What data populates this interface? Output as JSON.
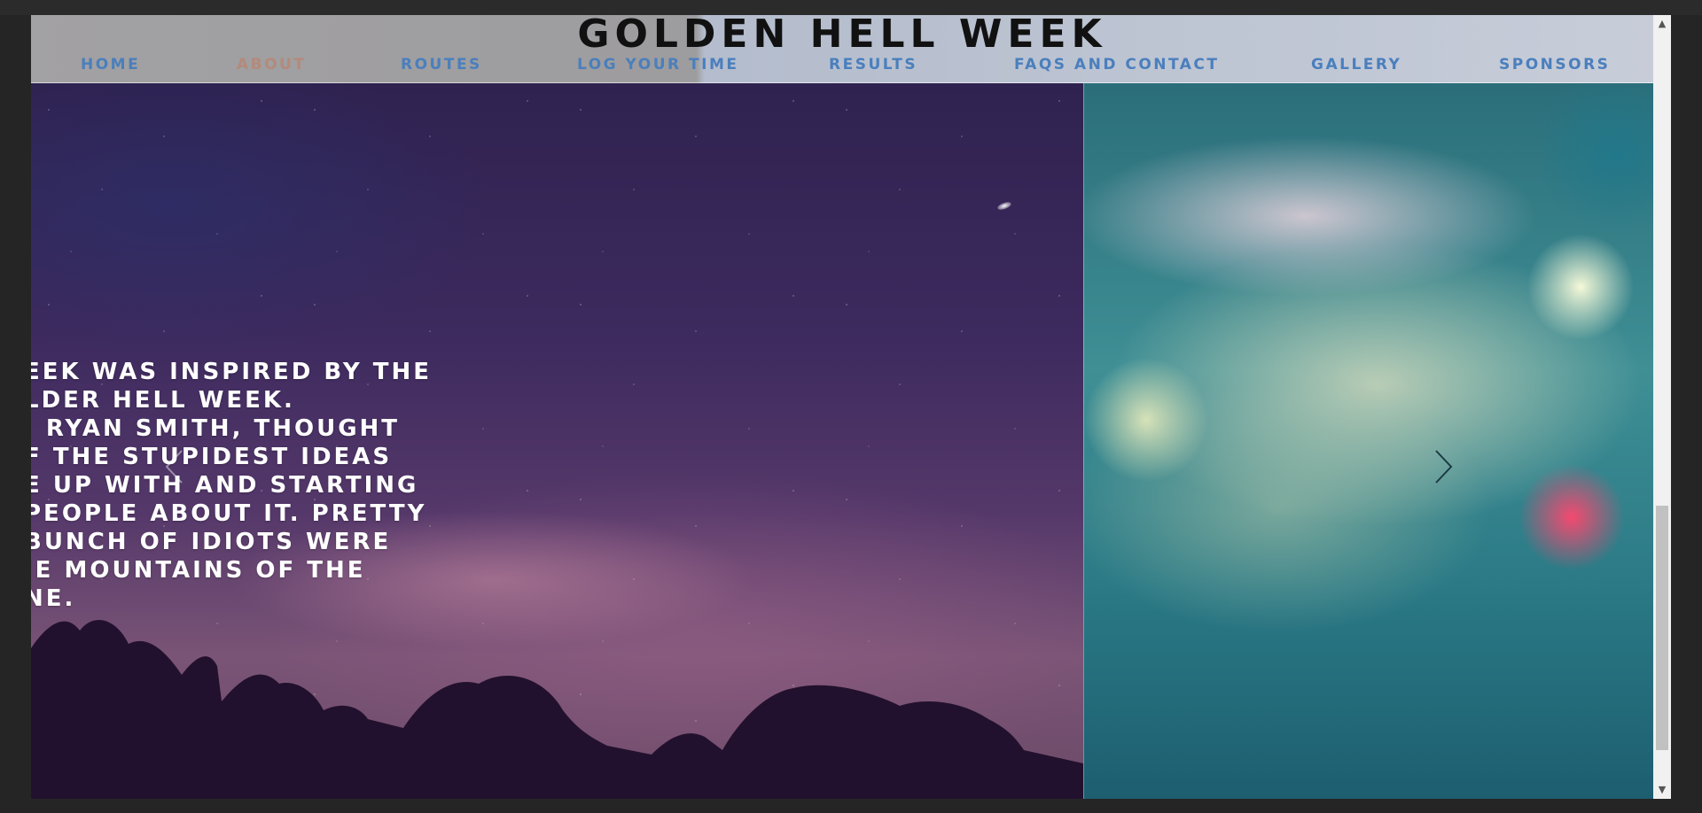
{
  "header": {
    "site_title": "GOLDEN HELL WEEK",
    "nav": [
      {
        "label": "HOME"
      },
      {
        "label": "ABOUT"
      },
      {
        "label": "ROUTES"
      },
      {
        "label": "LOG YOUR TIME"
      },
      {
        "label": "RESULTS"
      },
      {
        "label": "FAQS AND CONTACT"
      },
      {
        "label": "GALLERY"
      },
      {
        "label": "SPONSORS"
      }
    ],
    "active_nav": "ABOUT"
  },
  "slide": {
    "text_lines": [
      "EEK WAS INSPIRED BY THE",
      "LDER HELL WEEK.",
      ", RYAN SMITH, THOUGHT",
      "F THE STUPIDEST IDEAS",
      "E UP WITH AND STARTING",
      "PEOPLE ABOUT IT. PRETTY",
      "BUNCH OF IDIOTS WERE",
      "IE MOUNTAINS OF THE",
      "NE."
    ]
  },
  "colors": {
    "nav_link": "#4a7fbd",
    "nav_active": "#b48a7b",
    "title": "#111111"
  }
}
